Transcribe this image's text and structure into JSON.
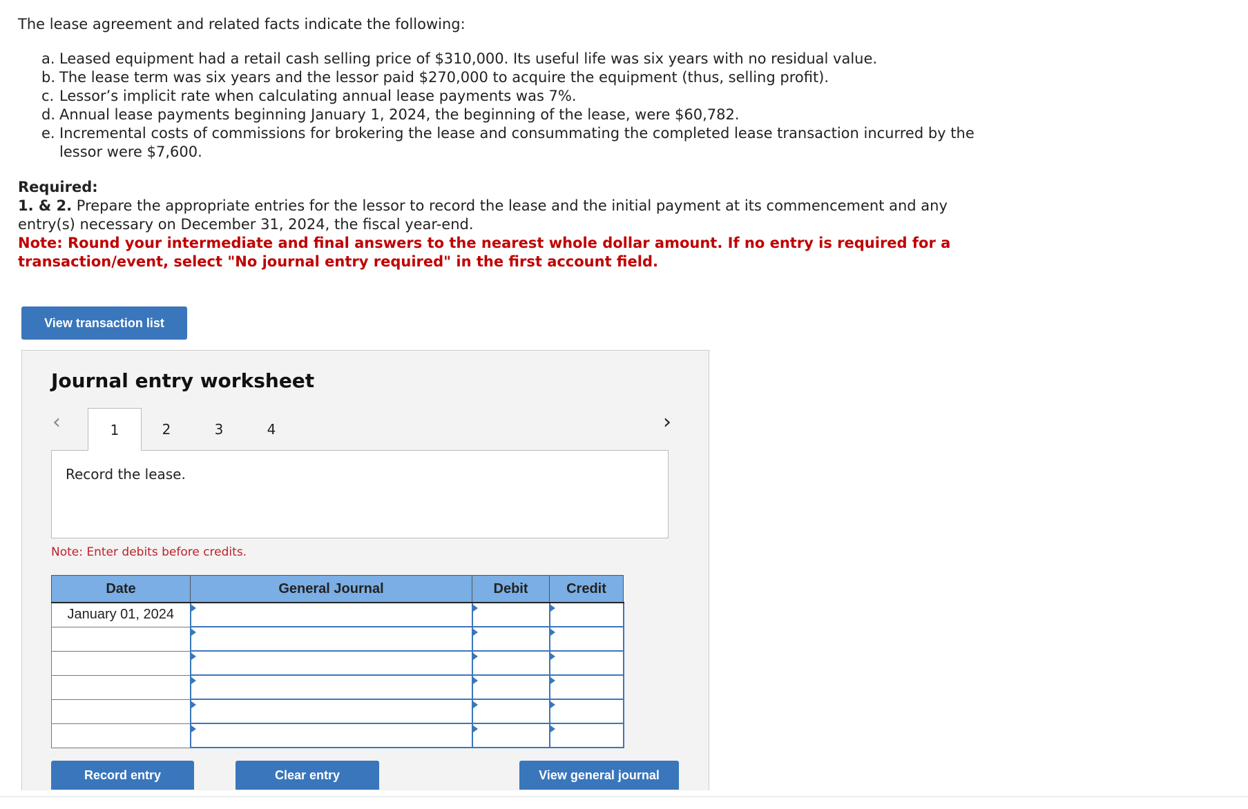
{
  "intro": "The lease agreement and related facts indicate the following:",
  "facts": [
    {
      "label": "a.",
      "text": "Leased equipment had a retail cash selling price of $310,000. Its useful life was six years with no residual value."
    },
    {
      "label": "b.",
      "text": "The lease term was six years and the lessor paid $270,000 to acquire the equipment (thus, selling profit)."
    },
    {
      "label": "c.",
      "text": "Lessor’s implicit rate when calculating annual lease payments was 7%."
    },
    {
      "label": "d.",
      "text": "Annual lease payments beginning January 1, 2024, the beginning of the lease, were $60,782."
    },
    {
      "label": "e.",
      "text": "Incremental costs of commissions for brokering the lease and consummating the completed lease transaction incurred by the lessor were $7,600."
    }
  ],
  "required": {
    "heading": "Required:",
    "num": "1. & 2.",
    "text": " Prepare the appropriate entries for the lessor to record the lease and the initial payment at its commencement and any entry(s) necessary on December 31, 2024, the fiscal year-end.",
    "note": "Note: Round your intermediate and final answers to the nearest whole dollar amount. If no entry is required for a transaction/event, select \"No journal entry required\" in the first account field."
  },
  "view_transaction_list": "View transaction list",
  "worksheet": {
    "title": "Journal entry worksheet",
    "prev": "‹",
    "next": "›",
    "tabs": [
      "1",
      "2",
      "3",
      "4"
    ],
    "active_tab": "1",
    "instruction": "Record the lease.",
    "note": "Note: Enter debits before credits.",
    "columns": [
      "Date",
      "General Journal",
      "Debit",
      "Credit"
    ],
    "rows": [
      {
        "date": "January 01, 2024",
        "account": "",
        "debit": "",
        "credit": ""
      },
      {
        "date": "",
        "account": "",
        "debit": "",
        "credit": ""
      },
      {
        "date": "",
        "account": "",
        "debit": "",
        "credit": ""
      },
      {
        "date": "",
        "account": "",
        "debit": "",
        "credit": ""
      },
      {
        "date": "",
        "account": "",
        "debit": "",
        "credit": ""
      },
      {
        "date": "",
        "account": "",
        "debit": "",
        "credit": ""
      }
    ],
    "record_entry": "Record entry",
    "clear_entry": "Clear entry",
    "view_general_journal": "View general journal"
  },
  "colors": {
    "button": "#3a76bb",
    "header": "#7aaee4",
    "note_red": "#c00000"
  }
}
